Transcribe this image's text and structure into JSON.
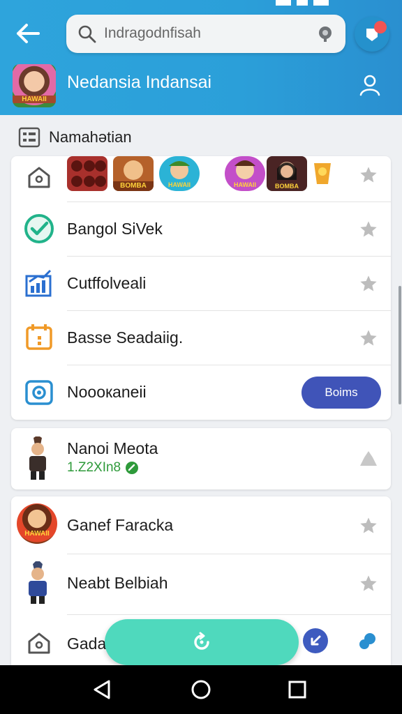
{
  "header": {
    "search_placeholder": "Indragodnfisah",
    "app_title": "Nedansia Indansai",
    "app_logo_text": "HAWAII"
  },
  "section": {
    "title": "Namahətian"
  },
  "card1": {
    "row1": {
      "thumbs": [
        {
          "label": "",
          "color": "#a8302c"
        },
        {
          "label": "BOMBA",
          "color": "#b5612a"
        },
        {
          "label": "HAWAII",
          "color": "#2bb3d6"
        },
        {
          "label": "HAWAII",
          "color": "#c34fc9"
        },
        {
          "label": "BOMBA",
          "color": "#4a2424"
        },
        {
          "label": "",
          "color": "#f0a72c"
        }
      ]
    },
    "row2": {
      "label": "Bangol SiVek"
    },
    "row3": {
      "label": "Cutffolvеali"
    },
    "row4": {
      "label": "Basse Seadaiig."
    },
    "row5": {
      "label": "Nooокaneiі",
      "button": "Boims"
    }
  },
  "card2": {
    "title": "Nanoi Meota",
    "subtitle": "1.Z2XIn8"
  },
  "card3": {
    "row1": {
      "label": "Ganef Faracka",
      "logo_text": "HAWAII"
    },
    "row2": {
      "label": "Neabt Belbiah"
    },
    "row3": {
      "label": "Gada"
    }
  },
  "colors": {
    "header": "#2ea4dc",
    "primary_button": "#4054b8",
    "fab": "#4fd9bd",
    "green_status": "#2e9a3a",
    "notification_dot": "#f25454"
  }
}
